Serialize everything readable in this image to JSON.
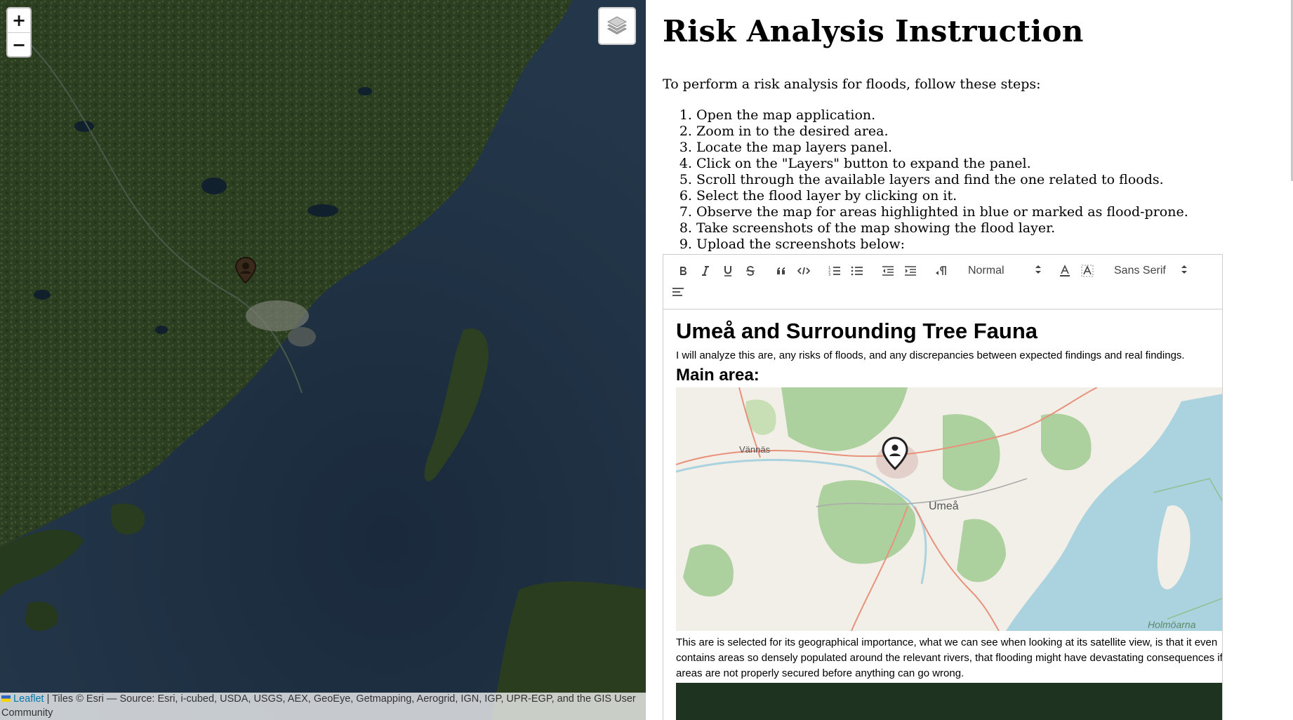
{
  "map": {
    "zoom_in_label": "+",
    "zoom_out_label": "−",
    "layers_icon": "layers-icon",
    "marker_icon": "map-pin-icon",
    "attribution": {
      "leaflet_text": "Leaflet",
      "rest_text": " | Tiles © Esri — Source: Esri, i-cubed, USDA, USGS, AEX, GeoEye, Getmapping, Aerogrid, IGN, IGP, UPR-EGP, and the GIS User Community"
    }
  },
  "instructions": {
    "title": "Risk Analysis Instruction",
    "intro": "To perform a risk analysis for floods, follow these steps:",
    "steps": [
      "Open the map application.",
      "Zoom in to the desired area.",
      "Locate the map layers panel.",
      "Click on the \"Layers\" button to expand the panel.",
      "Scroll through the available layers and find the one related to floods.",
      "Select the flood layer by clicking on it.",
      "Observe the map for areas highlighted in blue or marked as flood-prone.",
      "Take screenshots of the map showing the flood layer.",
      "Upload the screenshots below:"
    ]
  },
  "editor": {
    "toolbar": {
      "buttons": [
        "bold-icon",
        "italic-icon",
        "underline-icon",
        "strike-icon",
        "blockquote-icon",
        "code-icon",
        "ordered-list-icon",
        "bullet-list-icon",
        "outdent-icon",
        "indent-icon",
        "rtl-icon",
        "text-color-icon",
        "background-color-icon",
        "align-icon"
      ],
      "header_select": "Normal",
      "font_select": "Sans Serif"
    },
    "content": {
      "title": "Umeå and Surrounding Tree Fauna",
      "intro": "I will analyze this are, any risks of floods, and any discrepancies between expected findings and real findings.",
      "subheading": "Main area:",
      "map_labels": {
        "vannas": "Vännäs",
        "umea": "Umeå",
        "holmoarna": "Holmöarna"
      },
      "body": "This are is selected for its geographical importance, what we can see when looking at its satellite view, is that it even contains areas so densely populated around the relevant rivers, that flooding might have devastating consequences if the areas are not properly secured before anything can go wrong."
    }
  }
}
